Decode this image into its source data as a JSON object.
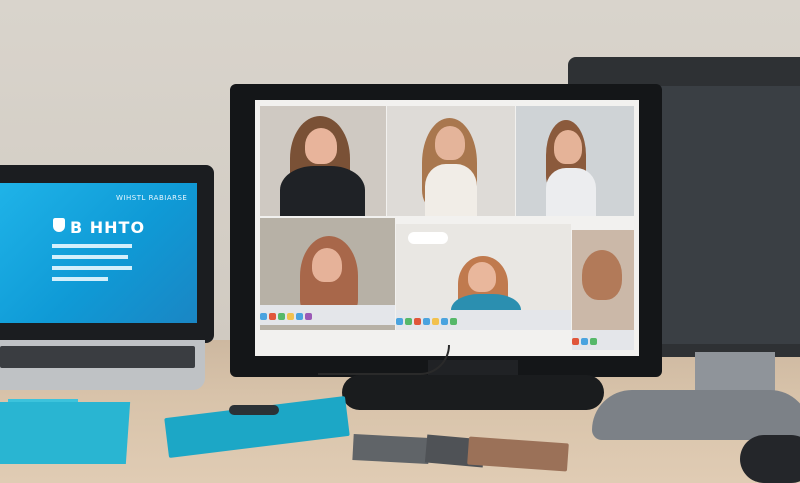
{
  "scene": {
    "description": "desk-setup-with-laptop-and-monitors",
    "colors": {
      "wall": "#d6d1c9",
      "desk": "#d6c1a7",
      "laptop_screen": "#1aa8df",
      "accent_teal": "#29b5d2",
      "monitor_black": "#141618"
    }
  },
  "laptop": {
    "brand_text": "WIHSTL RABIARSE",
    "title_text": "B HHTO"
  }
}
